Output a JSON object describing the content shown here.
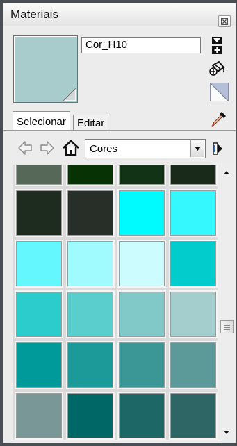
{
  "window": {
    "title": "Materiais"
  },
  "material": {
    "name": "Cor_H10",
    "preview_color": "#a7cccb"
  },
  "tabs": [
    {
      "label": "Selecionar",
      "active": true
    },
    {
      "label": "Editar",
      "active": false
    }
  ],
  "collection": {
    "selected": "Cores"
  },
  "swatch_colors": [
    "#566857",
    "#073304",
    "#133316",
    "#1a2a1a",
    "#1d2c1e",
    "#282e28",
    "#00fbff",
    "#35f8ff",
    "#64f8fe",
    "#a0fbff",
    "#cdfcff",
    "#02cccc",
    "#2ccbcc",
    "#5acdcd",
    "#80c9c8",
    "#a4cecd",
    "#009a9a",
    "#1c9a9a",
    "#3b9696",
    "#5b9a98",
    "#799797",
    "#006767",
    "#1d6767",
    "#2d6664"
  ],
  "icons": {
    "close": "close-icon",
    "create": "create-material-icon",
    "sample": "paint-bucket-icon",
    "default": "default-material-icon",
    "eyedropper": "eyedropper-icon",
    "back": "back-arrow-icon",
    "forward": "forward-arrow-icon",
    "home": "home-icon",
    "details": "details-icon"
  }
}
